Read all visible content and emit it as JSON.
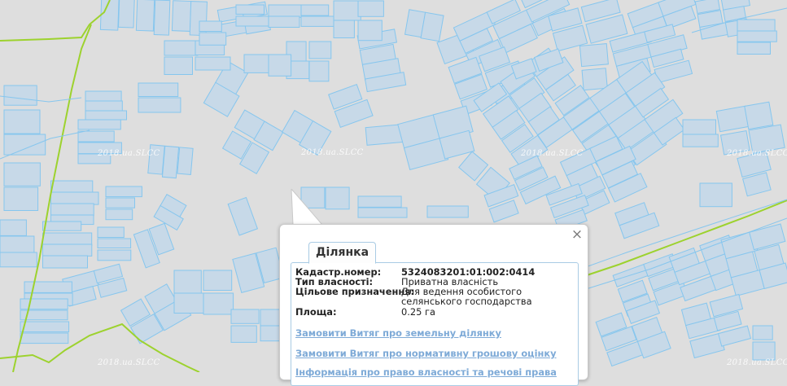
{
  "map": {
    "watermark": "2018.ua.SLCC",
    "colors": {
      "background": "#dedede",
      "parcel_fill": "#c7d9e8",
      "parcel_stroke": "#86c6ee",
      "boundary_line": "#9dd22e"
    }
  },
  "popup": {
    "tab_label": "Ділянка",
    "close_icon": "×",
    "fields": [
      {
        "label": "Кадастр.номер:",
        "value": "5324083201:01:002:0414"
      },
      {
        "label": "Тип власності:",
        "value": "Приватна власність"
      },
      {
        "label": "Цільове призначення:",
        "value": "Для ведення особистого селянського господарства"
      },
      {
        "label": "Площа:",
        "value": "0.25 га"
      }
    ],
    "links": [
      "Замовити Витяг про земельну ділянку",
      "Замовити Витяг про нормативну грошову оцінку",
      "Інформація про право власності та речові права"
    ]
  }
}
